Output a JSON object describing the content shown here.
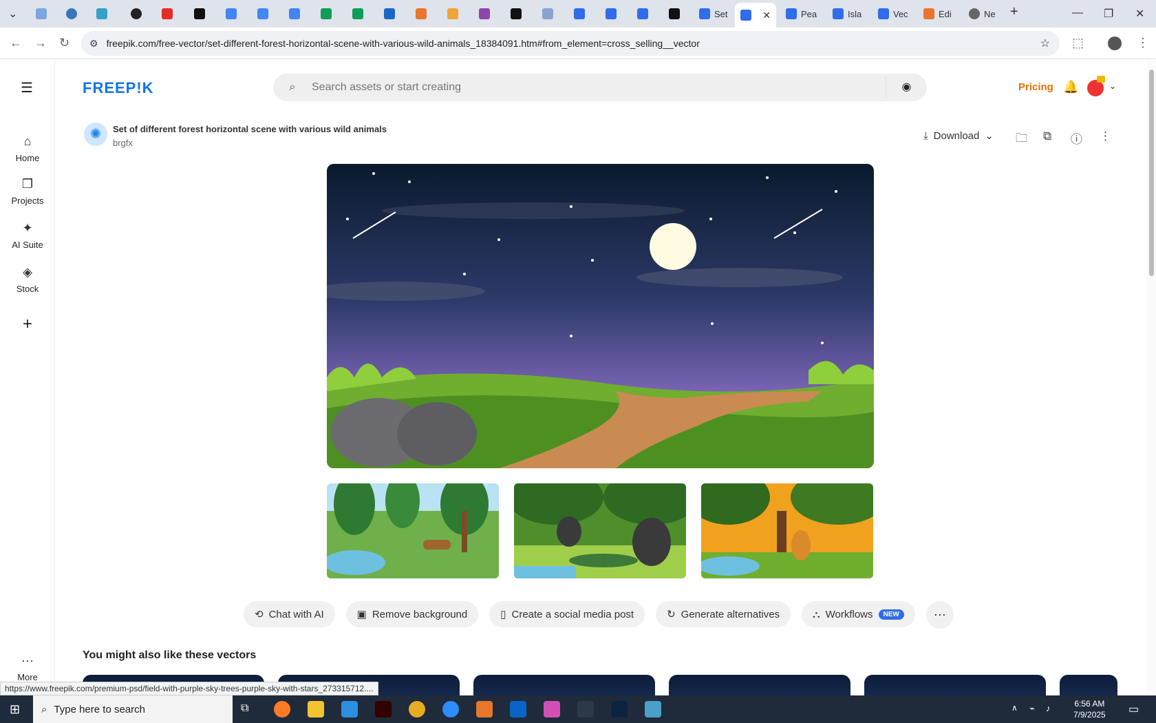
{
  "browser": {
    "active_tab_title": "Set",
    "tabs": [
      "Set",
      "Pea",
      "Isla",
      "Vec",
      "Edi",
      "Ne"
    ],
    "url": "freepik.com/free-vector/set-different-forest-horizontal-scene-with-various-wild-animals_18384091.htm#from_element=cross_selling__vector"
  },
  "nav": {
    "items": [
      {
        "label": "Home",
        "icon": "home-icon"
      },
      {
        "label": "Projects",
        "icon": "projects-icon"
      },
      {
        "label": "AI Suite",
        "icon": "sparkle-icon"
      },
      {
        "label": "Stock",
        "icon": "stock-icon"
      }
    ],
    "more_label": "More"
  },
  "header": {
    "logo": "FREEP!K",
    "search_placeholder": "Search assets or start creating",
    "pricing": "Pricing"
  },
  "asset": {
    "title": "Set of different forest horizontal scene with various wild animals",
    "author": "brgfx",
    "download_label": "Download"
  },
  "actions": [
    {
      "label": "Chat with AI"
    },
    {
      "label": "Remove background"
    },
    {
      "label": "Create a social media post"
    },
    {
      "label": "Generate alternatives"
    },
    {
      "label": "Workflows",
      "badge": "NEW"
    }
  ],
  "section_title": "You might also like these vectors",
  "status_url": "https://www.freepik.com/premium-psd/field-with-purple-sky-trees-purple-sky-with-stars_273315712....",
  "taskbar": {
    "search_placeholder": "Type here to search",
    "time": "6:56 AM",
    "date": "7/9/2025"
  },
  "colors": {
    "brand": "#1273eb",
    "pricing": "#e17000",
    "badge": "#2f6dea"
  }
}
